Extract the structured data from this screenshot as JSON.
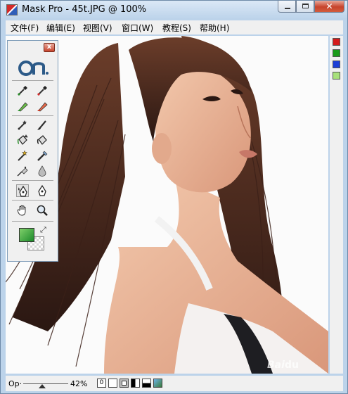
{
  "window": {
    "title": "Mask Pro - 45t.JPG @ 100%",
    "icon": "mask-pro-app-icon"
  },
  "window_buttons": {
    "minimize_icon": "minimize-icon",
    "maximize_icon": "maximize-icon",
    "close_icon": "close-icon"
  },
  "menu": {
    "items": [
      {
        "label": "文件(F)"
      },
      {
        "label": "编辑(E)"
      },
      {
        "label": "视图(V)"
      },
      {
        "label": "窗口(W)"
      },
      {
        "label": "教程(S)"
      },
      {
        "label": "帮助(H)"
      }
    ]
  },
  "toolbox": {
    "logo": "onOne-logo",
    "close_label": "x",
    "tools": [
      {
        "name": "keep-eyedropper-icon",
        "active": false
      },
      {
        "name": "drop-eyedropper-icon",
        "active": false
      },
      {
        "name": "keep-highlighter-icon",
        "active": false
      },
      {
        "name": "drop-highlighter-icon",
        "active": false
      },
      {
        "name": "magic-brush-icon",
        "active": false
      },
      {
        "name": "brush-icon",
        "active": false
      },
      {
        "name": "magic-bucket-icon",
        "active": false
      },
      {
        "name": "bucket-icon",
        "active": false
      },
      {
        "name": "magic-wand-icon",
        "active": false
      },
      {
        "name": "chisel-icon",
        "active": false
      },
      {
        "name": "eraser-icon",
        "active": false
      },
      {
        "name": "blur-icon",
        "active": false
      },
      {
        "name": "magic-pen-icon",
        "active": true
      },
      {
        "name": "pen-icon",
        "active": false
      },
      {
        "name": "hand-icon",
        "active": false
      },
      {
        "name": "zoom-icon",
        "active": false
      }
    ],
    "foreground_color": "#3aa84a",
    "swap_icon": "swap-colors-icon"
  },
  "swatches": {
    "colors": [
      "#d41b1b",
      "#1a9b1a",
      "#1d3fd6",
      "#a8e07a"
    ]
  },
  "status": {
    "opacity_label": "Op·",
    "opacity_level": 0.42,
    "zoom": "42%",
    "view_buttons": [
      {
        "label": "0",
        "active": false
      },
      {
        "label": "",
        "active": false
      },
      {
        "label": "",
        "active": true
      },
      {
        "label": "",
        "active": false
      },
      {
        "label": "",
        "active": false
      },
      {
        "label": "",
        "active": false
      }
    ]
  },
  "canvas": {
    "image": "portrait-photo"
  }
}
